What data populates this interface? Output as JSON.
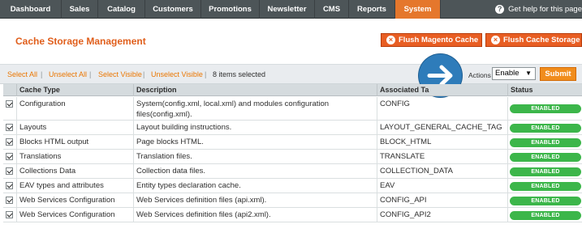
{
  "nav": {
    "items": [
      {
        "label": "Dashboard"
      },
      {
        "label": "Sales"
      },
      {
        "label": "Catalog"
      },
      {
        "label": "Customers"
      },
      {
        "label": "Promotions"
      },
      {
        "label": "Newsletter"
      },
      {
        "label": "CMS"
      },
      {
        "label": "Reports"
      },
      {
        "label": "System",
        "active": true
      }
    ],
    "help_label": "Get help for this page",
    "help_icon": "help-icon"
  },
  "header": {
    "title": "Cache Storage Management",
    "flush_magento_label": "Flush Magento Cache",
    "flush_storage_label": "Flush Cache Storage"
  },
  "massaction": {
    "select_all": "Select All",
    "unselect_all": "Unselect All",
    "select_visible": "Select Visible",
    "unselect_visible": "Unselect Visible",
    "selected_count": "8 items selected",
    "actions_label": "Actions",
    "actions_value": "Enable",
    "submit_label": "Submit"
  },
  "table": {
    "headers": {
      "type": "Cache Type",
      "description": "Description",
      "tags": "Associated Ta",
      "status": "Status"
    },
    "rows": [
      {
        "type": "Configuration",
        "description": "System(config.xml, local.xml) and modules configuration files(config.xml).",
        "tags": "CONFIG",
        "status": "ENABLED"
      },
      {
        "type": "Layouts",
        "description": "Layout building instructions.",
        "tags": "LAYOUT_GENERAL_CACHE_TAG",
        "status": "ENABLED"
      },
      {
        "type": "Blocks HTML output",
        "description": "Page blocks HTML.",
        "tags": "BLOCK_HTML",
        "status": "ENABLED"
      },
      {
        "type": "Translations",
        "description": "Translation files.",
        "tags": "TRANSLATE",
        "status": "ENABLED"
      },
      {
        "type": "Collections Data",
        "description": "Collection data files.",
        "tags": "COLLECTION_DATA",
        "status": "ENABLED"
      },
      {
        "type": "EAV types and attributes",
        "description": "Entity types declaration cache.",
        "tags": "EAV",
        "status": "ENABLED"
      },
      {
        "type": "Web Services Configuration",
        "description": "Web Services definition files (api.xml).",
        "tags": "CONFIG_API",
        "status": "ENABLED"
      },
      {
        "type": "Web Services Configuration",
        "description": "Web Services definition files (api2.xml).",
        "tags": "CONFIG_API2",
        "status": "ENABLED"
      }
    ]
  },
  "colors": {
    "accent": "#e5772c",
    "title": "#e05e1b",
    "enabled": "#3cb64a",
    "arrow_circle": "#2e7cba"
  }
}
